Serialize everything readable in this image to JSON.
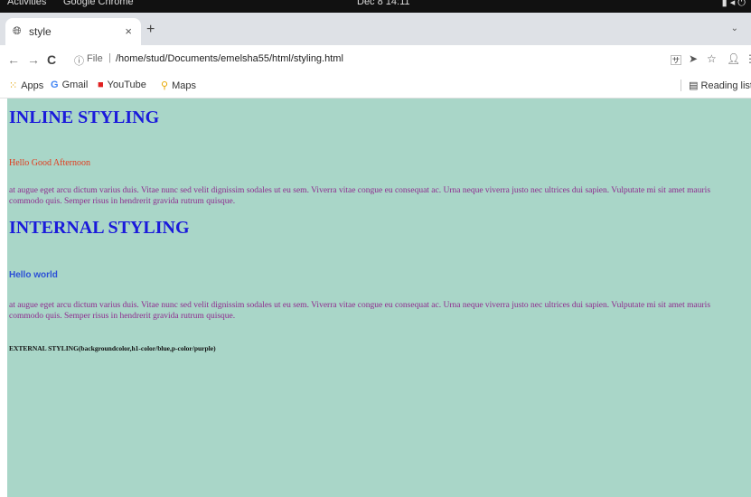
{
  "os": {
    "activities": "Activities",
    "app_name": "Google Chrome",
    "clock": "Dec 8  14:11"
  },
  "browser": {
    "tab": {
      "title": "style"
    },
    "new_tab_symbol": "+",
    "address": {
      "scheme": "File",
      "url": "/home/stud/Documents/emelsha55/html/styling.html"
    },
    "bookmarks": [
      {
        "label": "Apps"
      },
      {
        "label": "Gmail"
      },
      {
        "label": "YouTube"
      },
      {
        "label": "Maps"
      }
    ],
    "reading_list": "Reading list"
  },
  "page": {
    "inline_heading": "INLINE STYLING",
    "inline_hello": "Hello Good Afternoon",
    "lorem_1": "at augue eget arcu dictum varius duis. Vitae nunc sed velit dignissim sodales ut eu sem. Viverra vitae congue eu consequat ac. Urna neque viverra justo nec ultrices dui sapien. Vulputate mi sit amet mauris commodo quis. Semper risus in hendrerit gravida rutrum quisque.",
    "internal_heading": "INTERNAL STYLING",
    "internal_hello": "Hello world",
    "lorem_2": "at augue eget arcu dictum varius duis. Vitae nunc sed velit dignissim sodales ut eu sem. Viverra vitae congue eu consequat ac. Urna neque viverra justo nec ultrices dui sapien. Vulputate mi sit amet mauris commodo quis. Semper risus in hendrerit gravida rutrum quisque.",
    "external_note": "EXTERNAL STYLING(backgroundcolor,h1-color/blue,p-color/purple)"
  }
}
